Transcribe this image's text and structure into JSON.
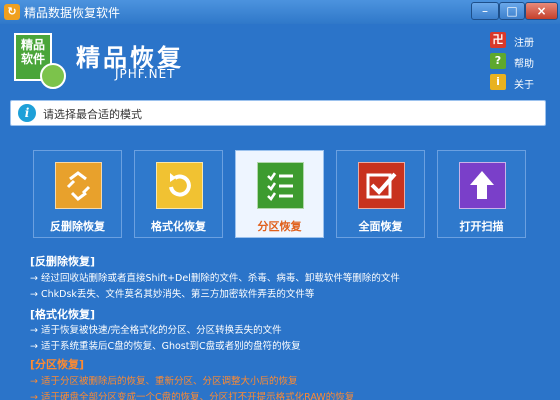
{
  "window": {
    "title": "精品数据恢复软件",
    "minimize": "–",
    "maximize": "□",
    "close": "×"
  },
  "header": {
    "brand": "精品恢复",
    "site": "JPHF.NET",
    "logo_text": "精品\n软件",
    "links": [
      {
        "label": "注册",
        "icon": "register-icon",
        "color": "#d9392b",
        "glyph": "卍"
      },
      {
        "label": "帮助",
        "icon": "help-icon",
        "color": "#5ea82e",
        "glyph": "?"
      },
      {
        "label": "关于",
        "icon": "about-icon",
        "color": "#e8b220",
        "glyph": "i"
      }
    ]
  },
  "info": {
    "text": "请选择最合适的模式"
  },
  "modes": [
    {
      "label": "反删除恢复",
      "color": "#e8a12c",
      "icon": "recycle-icon",
      "active": false
    },
    {
      "label": "格式化恢复",
      "color": "#f1c232",
      "icon": "refresh-icon",
      "active": false
    },
    {
      "label": "分区恢复",
      "color": "#3d9b2f",
      "icon": "checklist-icon",
      "active": true
    },
    {
      "label": "全面恢复",
      "color": "#c8321e",
      "icon": "check-box-icon",
      "active": false
    },
    {
      "label": "打开扫描",
      "color": "#7a3fc9",
      "icon": "up-arrow-icon",
      "active": false
    }
  ],
  "descriptions": [
    {
      "text": "[反删除恢复]",
      "heading": true,
      "highlight": false
    },
    {
      "text": "→ 经过回收站删除或者直接Shift+Del删除的文件、杀毒、病毒、卸载软件等删除的文件",
      "heading": false,
      "highlight": false
    },
    {
      "text": "→ ChkDsk丢失、文件莫名其妙消失、第三方加密软件弄丢的文件等",
      "heading": false,
      "highlight": false
    },
    {
      "text": "[格式化恢复]",
      "heading": true,
      "highlight": false
    },
    {
      "text": "→ 适于恢复被快速/完全格式化的分区、分区转换丢失的文件",
      "heading": false,
      "highlight": false
    },
    {
      "text": "→ 适于系统重装后C盘的恢复、Ghost到C盘或者别的盘符的恢复",
      "heading": false,
      "highlight": false
    },
    {
      "text": "[分区恢复]",
      "heading": true,
      "highlight": true
    },
    {
      "text": "→ 适于分区被删除后的恢复、重新分区、分区调整大小后的恢复",
      "heading": false,
      "highlight": true
    },
    {
      "text": "→ 适于硬盘全部分区变成一个C盘的恢复、分区打不开提示格式化RAW的恢复",
      "heading": false,
      "highlight": true
    }
  ]
}
